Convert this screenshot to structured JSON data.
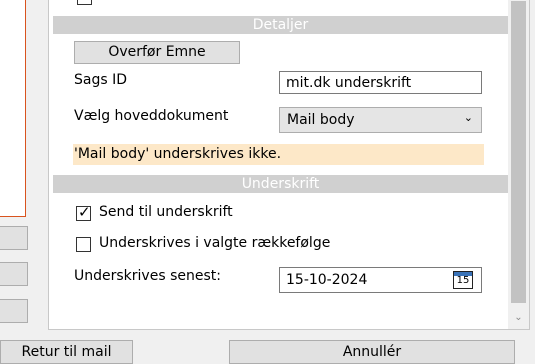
{
  "details_header": "Detaljer",
  "transfer_button": "Overfør Emne",
  "case_id_label": "Sags ID",
  "case_id_value": "mit.dk underskrift",
  "main_doc_label": "Vælg hoveddokument",
  "main_doc_value": "Mail body",
  "warning_text": "'Mail body' underskrives ikke.",
  "signature_header": "Underskrift",
  "send_for_signature": {
    "label": "Send til underskrift",
    "checked": true
  },
  "signed_in_order": {
    "label": "Underskrives i valgte rækkefølge",
    "checked": false
  },
  "deadline_label": "Underskrives senest:",
  "deadline_value": "15-10-2024",
  "calendar_day": "15",
  "return_button": "Retur til mail",
  "cancel_button": "Annullér",
  "colors": {
    "section_header": "#d0d0d0",
    "warning_bg": "#fde8c8",
    "left_panel_border": "#d9531e"
  }
}
